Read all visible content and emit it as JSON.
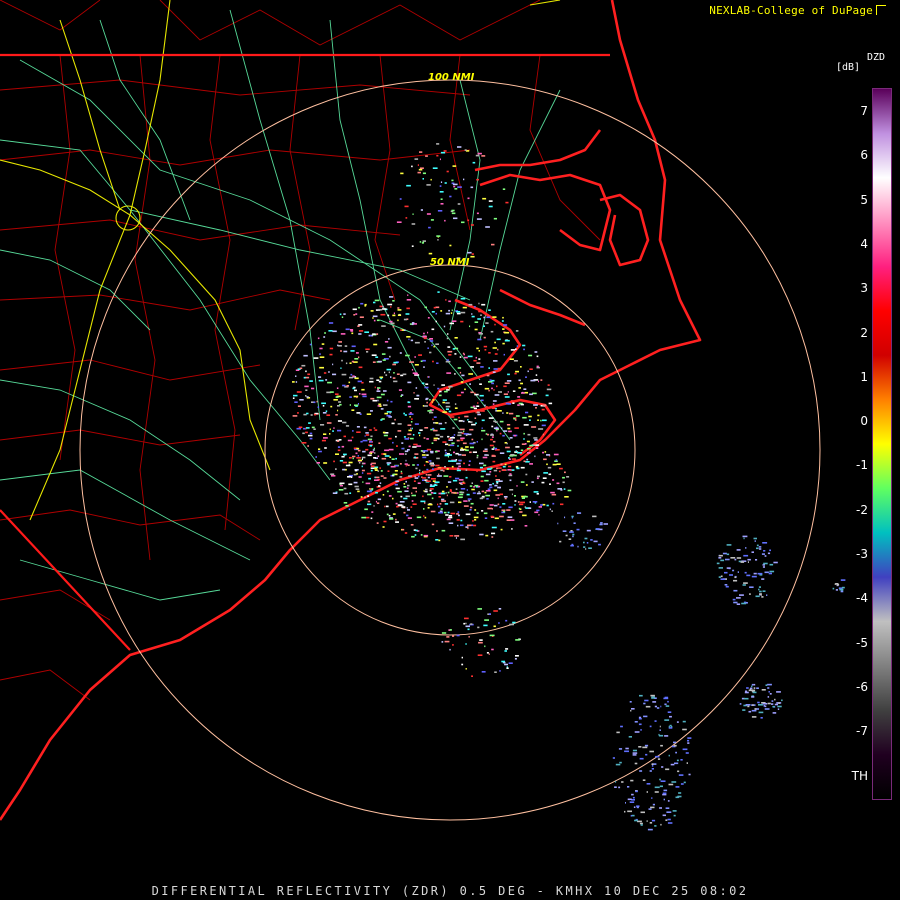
{
  "header": {
    "credit": "NEXLAB-College of DuPage",
    "credit_icon": "corner-bracket-icon"
  },
  "footer": {
    "title": "DIFFERENTIAL REFLECTIVITY (ZDR) 0.5 DEG - KMHX 10 DEC 25 08:02"
  },
  "range_rings": [
    {
      "label": "50 NMI"
    },
    {
      "label": "100 NMI"
    }
  ],
  "legend": {
    "product": "DZD",
    "unit": "[dB]",
    "ticks": [
      "7",
      "6",
      "5",
      "4",
      "3",
      "2",
      "1",
      "0",
      "-1",
      "-2",
      "-3",
      "-4",
      "-5",
      "-6",
      "-7",
      "TH"
    ],
    "gradient": [
      "#5a005a",
      "#c090e0",
      "#ffffff",
      "#ff90c0",
      "#ff2080",
      "#ff0000",
      "#d00000",
      "#ff8000",
      "#ffff00",
      "#60ff60",
      "#00c0c0",
      "#4040c0",
      "#c0c0c0",
      "#808080",
      "#404040",
      "#200020",
      "#000000"
    ]
  },
  "colors": {
    "state_border": "#ff1a1a",
    "county_border": "#b00000",
    "highway": "#ffff00",
    "road": "#66ffb3",
    "coastline": "#ff2020",
    "range_ring": "#ffc0a0",
    "background": "#000000"
  }
}
